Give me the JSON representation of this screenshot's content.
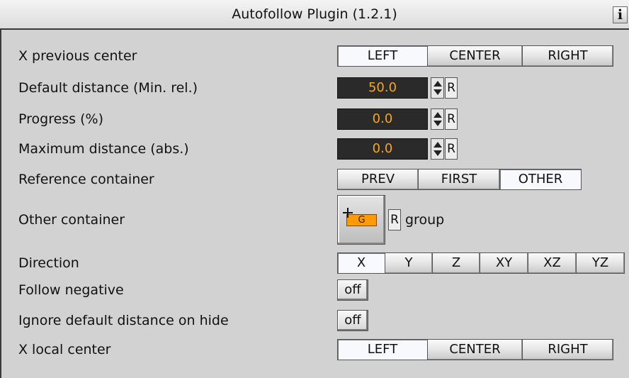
{
  "window": {
    "title": "Autofollow Plugin (1.2.1)",
    "info_label": "i"
  },
  "rows": {
    "x_previous_center": {
      "label": "X previous center",
      "options": [
        "LEFT",
        "CENTER",
        "RIGHT"
      ],
      "selected": "LEFT"
    },
    "default_distance": {
      "label": "Default distance (Min. rel.)",
      "value": "50.0",
      "reset_label": "R"
    },
    "progress": {
      "label": "Progress (%)",
      "value": "0.0",
      "reset_label": "R"
    },
    "maximum_distance": {
      "label": "Maximum distance (abs.)",
      "value": "0.0",
      "reset_label": "R"
    },
    "reference_container": {
      "label": "Reference container",
      "options": [
        "PREV",
        "FIRST",
        "OTHER"
      ],
      "selected": "OTHER"
    },
    "other_container": {
      "label": "Other container",
      "icon_text": "G",
      "reset_label": "R",
      "container_name": "group"
    },
    "direction": {
      "label": "Direction",
      "options": [
        "X",
        "Y",
        "Z",
        "XY",
        "XZ",
        "YZ"
      ],
      "selected": "X"
    },
    "follow_negative": {
      "label": "Follow negative",
      "value": "off"
    },
    "ignore_default_distance": {
      "label": "Ignore default distance on hide",
      "value": "off"
    },
    "x_local_center": {
      "label": "X local center",
      "options": [
        "LEFT",
        "CENTER",
        "RIGHT"
      ],
      "selected": "LEFT"
    }
  },
  "colors": {
    "panel_bg": "#d2d2d2",
    "field_bg": "#2a2a2a",
    "field_text": "#f5a623",
    "group_icon": "#ff9a00"
  }
}
